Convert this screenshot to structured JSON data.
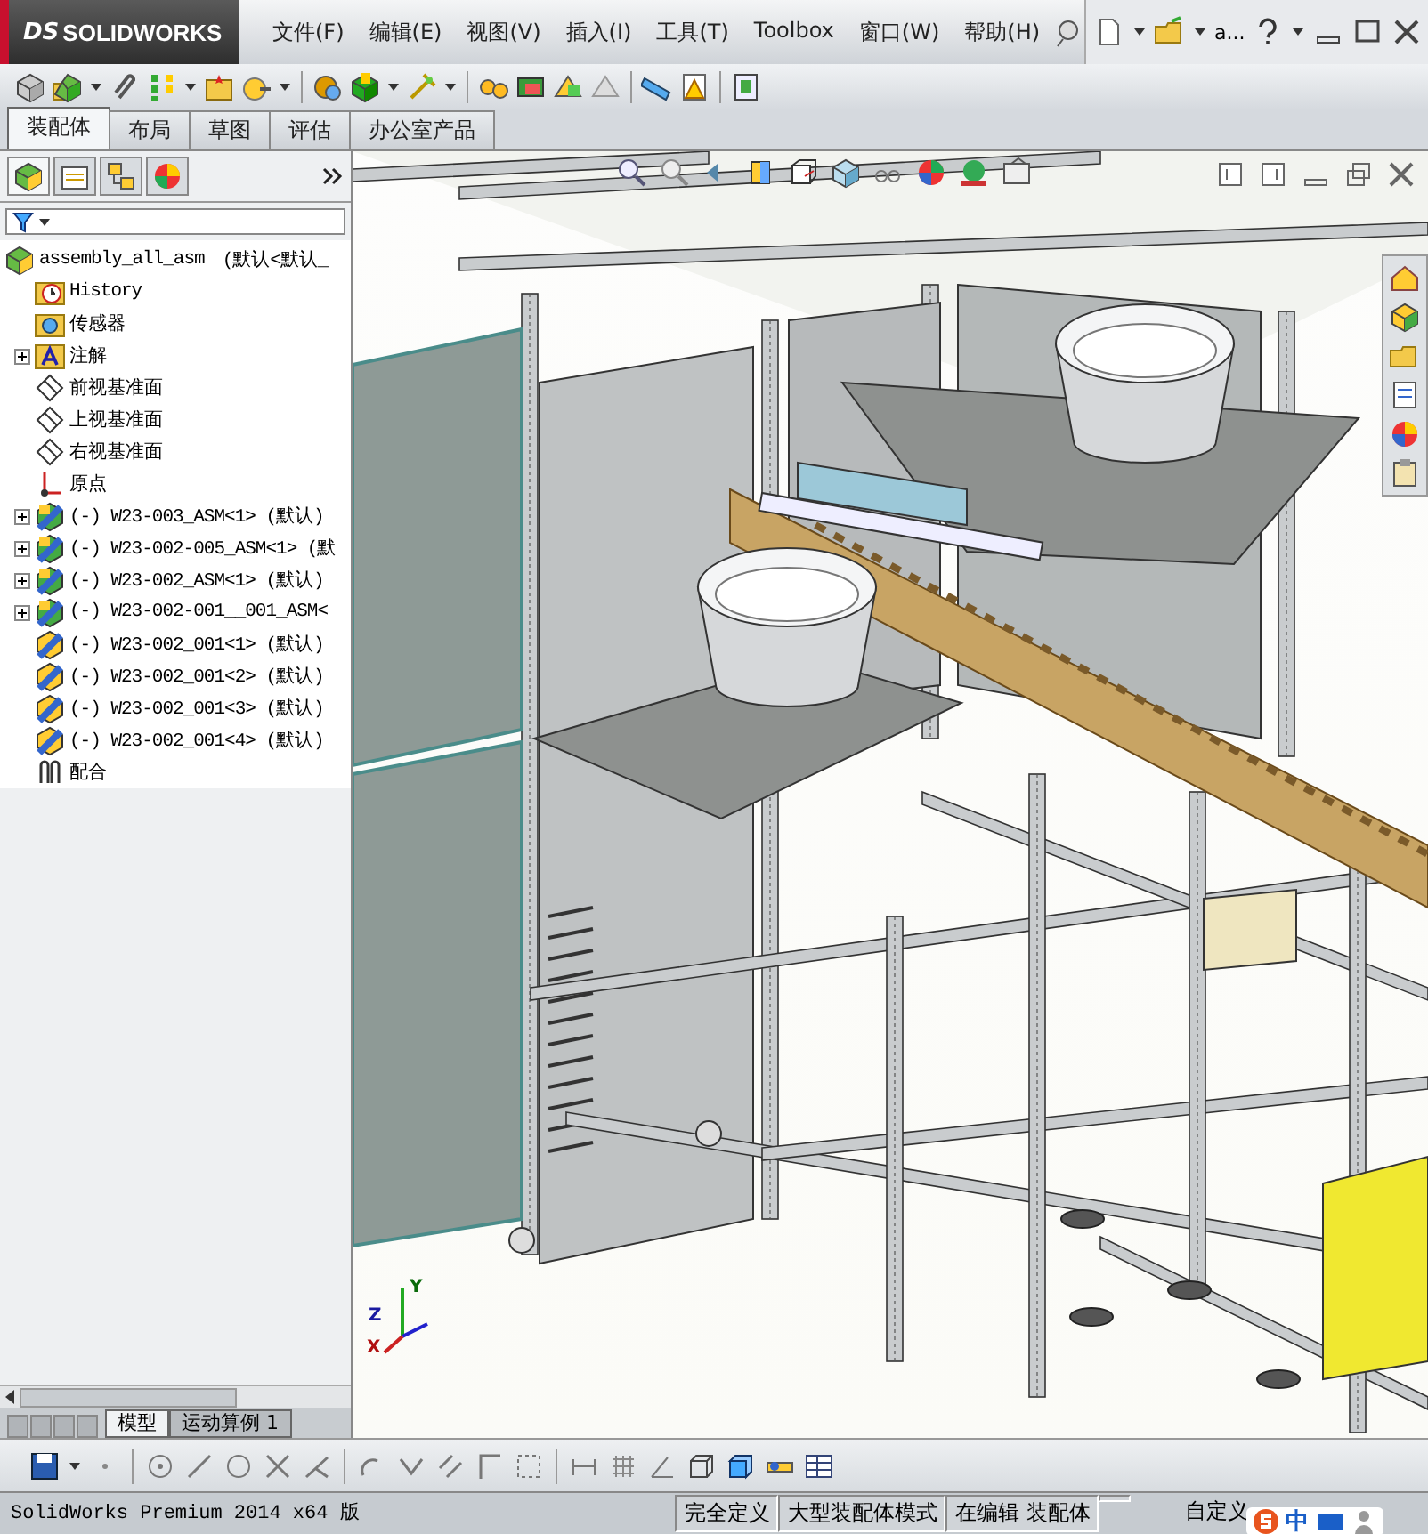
{
  "window": {
    "logo_mark": "DS",
    "logo": "SOLIDWORKS",
    "menu": [
      "文件(F)",
      "编辑(E)",
      "视图(V)",
      "插入(I)",
      "工具(T)",
      "Toolbox",
      "窗口(W)",
      "帮助(H)"
    ],
    "search_label": "a..."
  },
  "command_tabs": [
    {
      "label": "装配体",
      "selected": true
    },
    {
      "label": "布局",
      "selected": false
    },
    {
      "label": "草图",
      "selected": false
    },
    {
      "label": "评估",
      "selected": false
    },
    {
      "label": "办公室产品",
      "selected": false
    }
  ],
  "feature_tree": {
    "items": [
      {
        "kind": "root",
        "label": "assembly_all_asm",
        "config": "(默认<默认_",
        "expandable": false
      },
      {
        "kind": "history",
        "label": "History",
        "expandable": false
      },
      {
        "kind": "sensor",
        "label": "传感器",
        "expandable": false
      },
      {
        "kind": "annotation",
        "label": "注解",
        "expandable": true
      },
      {
        "kind": "plane",
        "label": "前视基准面",
        "expandable": false
      },
      {
        "kind": "plane",
        "label": "上视基准面",
        "expandable": false
      },
      {
        "kind": "plane",
        "label": "右视基准面",
        "expandable": false
      },
      {
        "kind": "origin",
        "label": "原点",
        "expandable": false
      },
      {
        "kind": "subassembly",
        "label": "(-) W23-003_ASM<1> (默认)",
        "expandable": true
      },
      {
        "kind": "subassembly",
        "label": "(-) W23-002-005_ASM<1> (默",
        "expandable": true
      },
      {
        "kind": "subassembly",
        "label": "(-) W23-002_ASM<1> (默认)",
        "expandable": true
      },
      {
        "kind": "subassembly",
        "label": "(-) W23-002-001__001_ASM<",
        "expandable": true
      },
      {
        "kind": "part",
        "label": "(-) W23-002_001<1> (默认)",
        "expandable": false
      },
      {
        "kind": "part",
        "label": "(-) W23-002_001<2> (默认)",
        "expandable": false
      },
      {
        "kind": "part",
        "label": "(-) W23-002_001<3> (默认)",
        "expandable": false
      },
      {
        "kind": "part",
        "label": "(-) W23-002_001<4> (默认)",
        "expandable": false
      },
      {
        "kind": "mates",
        "label": "配合",
        "expandable": false
      }
    ]
  },
  "triad": {
    "x": "X",
    "y": "Y",
    "z": "Z"
  },
  "bottom_tabs": [
    {
      "label": "模型",
      "selected": true
    },
    {
      "label": "运动算例 1",
      "selected": false
    }
  ],
  "status_bar": {
    "product": "SolidWorks Premium 2014 x64 版",
    "fields": [
      "完全定义",
      "大型装配体模式",
      "在编辑 装配体"
    ],
    "custom": "自定义"
  },
  "ime_bar": {
    "mode": "中"
  }
}
